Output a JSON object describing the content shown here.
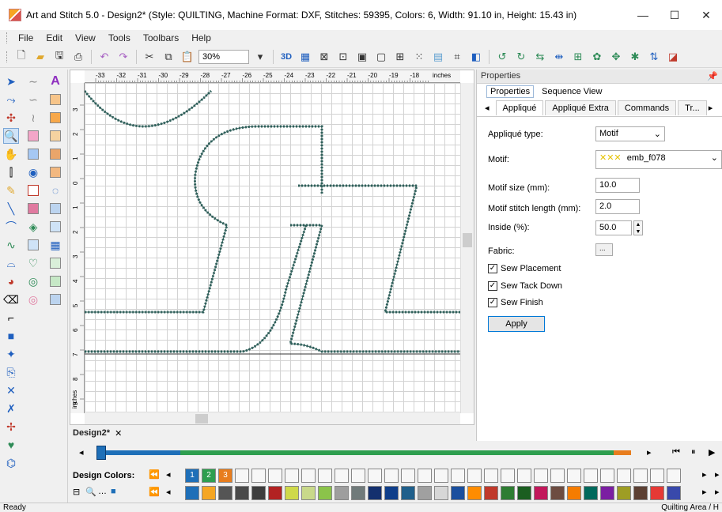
{
  "window": {
    "title": "Art and Stitch 5.0 - Design2* (Style: QUILTING, Machine Format: DXF, Stitches: 59395, Colors: 6, Width: 91.10 in, Height: 15.43 in)",
    "minimize": "—",
    "maximize": "☐",
    "close": "✕"
  },
  "menu": [
    "File",
    "Edit",
    "View",
    "Tools",
    "Toolbars",
    "Help"
  ],
  "toolbar": {
    "zoom": "30%"
  },
  "ruler": {
    "h_ticks": [
      "-33",
      "-32",
      "-31",
      "-30",
      "-29",
      "-28",
      "-27",
      "-26",
      "-25",
      "-24",
      "-23",
      "-22",
      "-21",
      "-20",
      "-19",
      "-18"
    ],
    "h_unit": "inches",
    "v_ticks": [
      "3",
      "2",
      "1",
      "0",
      "1",
      "2",
      "3",
      "4",
      "5",
      "6",
      "7",
      "8",
      "9"
    ],
    "v_unit": "inches"
  },
  "document_tab": {
    "label": "Design2*",
    "close": "✕"
  },
  "properties": {
    "title": "Properties",
    "pin": "ᵖ",
    "view_tabs": [
      "Properties",
      "Sequence View"
    ],
    "sub_tabs": [
      "Appliqué",
      "Appliqué Extra",
      "Commands",
      "Tr..."
    ],
    "fields": {
      "applique_type_label": "Appliqué type:",
      "applique_type_value": "Motif",
      "motif_label": "Motif:",
      "motif_value": "emb_f078",
      "motif_size_label": "Motif size (mm):",
      "motif_size_value": "10.0",
      "motif_stitch_length_label": "Motif stitch length (mm):",
      "motif_stitch_length_value": "2.0",
      "inside_label": "Inside (%):",
      "inside_value": "50.0",
      "fabric_label": "Fabric:",
      "fabric_button": "..."
    },
    "checks": [
      {
        "label": "Sew Placement",
        "checked": true
      },
      {
        "label": "Sew Tack Down",
        "checked": true
      },
      {
        "label": "Sew Finish",
        "checked": true
      }
    ],
    "apply_label": "Apply"
  },
  "design_colors": {
    "label": "Design Colors:",
    "slots": [
      "1",
      "2",
      "3"
    ],
    "slot_colors": [
      "#1e6fb8",
      "#2e9e4f",
      "#e87d1e"
    ],
    "palette": [
      "#1e6fb8",
      "#f5a623",
      "#555555",
      "#4a4a4a",
      "#3d3d3d",
      "#b22222",
      "#cfd94a",
      "#c9d98a",
      "#8bc34a",
      "#9e9e9e",
      "#707a7a",
      "#14306e",
      "#0f3e8a",
      "#1f5f8b",
      "#a0a0a0",
      "#d7d7d7",
      "#1a4f9e",
      "#ff8c00",
      "#c0392b",
      "#2e7d32",
      "#1b5e20",
      "#c2185b",
      "#6d4c41",
      "#f57c00",
      "#00695c",
      "#7b1fa2",
      "#9e9d24",
      "#5c4033",
      "#e53935",
      "#3949ab"
    ]
  },
  "status": {
    "left": "Ready",
    "right": "Quilting Area / H"
  }
}
